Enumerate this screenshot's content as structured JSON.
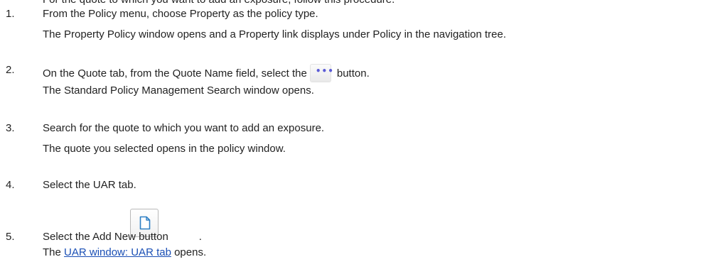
{
  "cut_text": "For the quote to which you want to add an exposure, follow this procedure.",
  "steps": [
    {
      "num": "1.",
      "action": "From the Policy menu, choose Property as the policy type.",
      "result": "The Property Policy window opens and a Property link displays under Policy in the navigation tree."
    },
    {
      "num": "2.",
      "action_before": "On the Quote tab, from the Quote Name field, select the",
      "action_after": "button.",
      "icon": "ellipsis-button-icon",
      "result": "The Standard Policy Management Search window opens."
    },
    {
      "num": "3.",
      "action": "Search for the quote to which you want to add an exposure.",
      "result": "The quote you selected opens in the policy window."
    },
    {
      "num": "4.",
      "action": "Select the UAR tab."
    },
    {
      "num": "5.",
      "action_before": "Select the Add New button",
      "action_after": ".",
      "icon": "new-document-icon",
      "result_before": "The",
      "result_link": "UAR window: UAR tab",
      "result_after": "opens."
    }
  ],
  "colors": {
    "text": "#222222",
    "link": "#1a4fb5",
    "ellipsis_dots": "#5b5bd6"
  }
}
